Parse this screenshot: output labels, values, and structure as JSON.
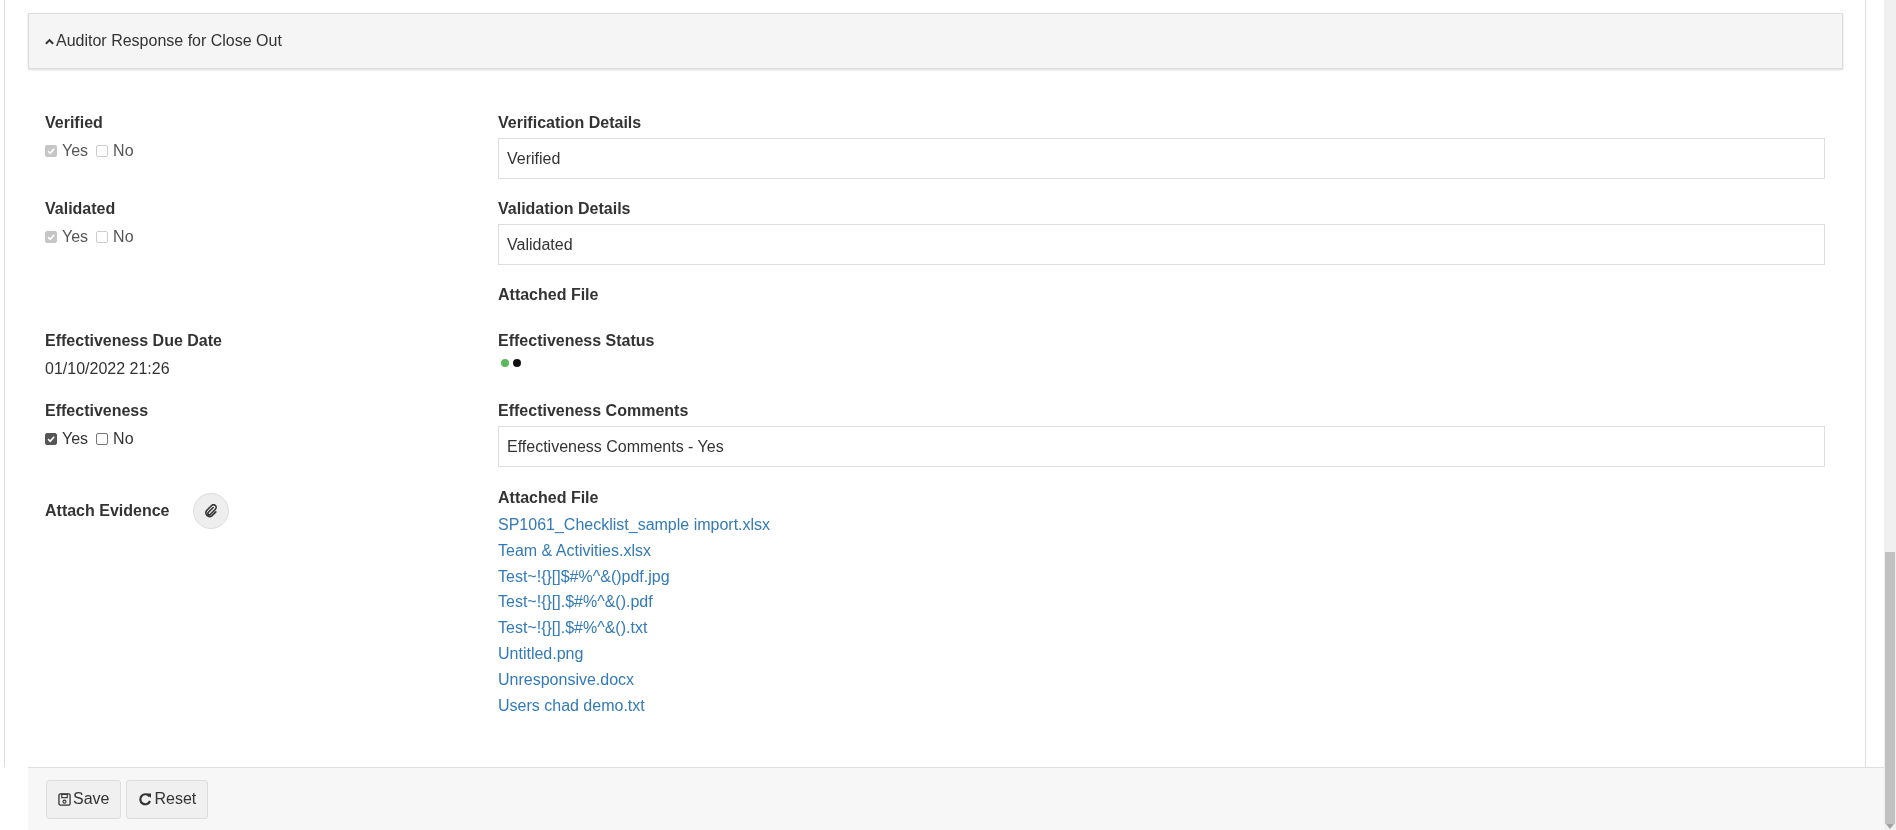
{
  "section": {
    "title": "Auditor Response for Close Out",
    "expanded": true
  },
  "verified": {
    "label": "Verified",
    "options": [
      {
        "label": "Yes",
        "checked": true,
        "disabled": true
      },
      {
        "label": "No",
        "checked": false,
        "disabled": true
      }
    ]
  },
  "verification_details": {
    "label": "Verification Details",
    "value": "Verified"
  },
  "validated": {
    "label": "Validated",
    "options": [
      {
        "label": "Yes",
        "checked": true,
        "disabled": true
      },
      {
        "label": "No",
        "checked": false,
        "disabled": true
      }
    ]
  },
  "validation_details": {
    "label": "Validation Details",
    "value": "Validated"
  },
  "attached_file_top": {
    "label": "Attached File"
  },
  "effectiveness_due_date": {
    "label": "Effectiveness Due Date",
    "value": "01/10/2022 21:26"
  },
  "effectiveness_status": {
    "label": "Effectiveness Status",
    "dots": [
      {
        "color": "#5cb85c"
      },
      {
        "color": "#111111"
      }
    ]
  },
  "effectiveness": {
    "label": "Effectiveness",
    "options": [
      {
        "label": "Yes",
        "checked": true,
        "disabled": false
      },
      {
        "label": "No",
        "checked": false,
        "disabled": false
      }
    ]
  },
  "effectiveness_comments": {
    "label": "Effectiveness Comments",
    "value": "Effectiveness Comments - Yes"
  },
  "attach_evidence": {
    "label": "Attach Evidence"
  },
  "attached_files": {
    "label": "Attached File",
    "files": [
      "SP1061_Checklist_sample import.xlsx",
      "Team & Activities.xlsx",
      "Test~!{}[]$#%^&()pdf.jpg",
      "Test~!{}[].$#%^&().pdf",
      "Test~!{}[].$#%^&().txt",
      "Untitled.png",
      "Unresponsive.docx",
      "Users chad demo.txt"
    ]
  },
  "buttons": [
    {
      "kind": "save",
      "label": "Save"
    },
    {
      "kind": "reset",
      "label": "Reset"
    }
  ]
}
